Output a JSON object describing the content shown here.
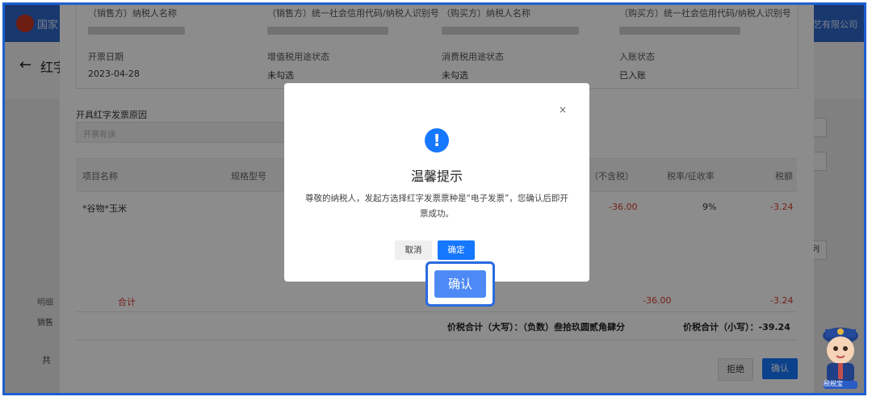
{
  "app": {
    "title_partial": "国家",
    "company_partial": "艺有限公司"
  },
  "page": {
    "title_partial": "红字"
  },
  "background_left": {
    "label1": "明细",
    "label2": "销售",
    "label3": "共"
  },
  "right_side": {
    "button_partial": "列"
  },
  "invoice_info": {
    "seller_name_label": "（销售方）纳税人名称",
    "seller_id_label": "（销售方）统一社会信用代码/纳税人识别号",
    "buyer_name_label": "（购买方）纳税人名称",
    "buyer_id_label": "（购买方）统一社会信用代码/纳税人识别号",
    "issue_date_label": "开票日期",
    "issue_date_value": "2023-04-28",
    "vat_use_status_label": "增值税用途状态",
    "vat_use_status_value": "未勾选",
    "consumption_tax_status_label": "消费税用途状态",
    "consumption_tax_status_value": "未勾选",
    "accounting_status_label": "入账状态",
    "accounting_status_value": "已入账"
  },
  "reason": {
    "label": "开具红字发票原因",
    "value": "开票有误"
  },
  "table": {
    "headers": [
      "项目名称",
      "规格型号",
      "（不含税）",
      "税率/征收率",
      "税额"
    ],
    "rows": [
      {
        "item": "*谷物*玉米",
        "amount": "-36.00",
        "rate": "9%",
        "tax": "-3.24"
      }
    ],
    "total_label": "合计",
    "total_amount": "-36.00",
    "total_tax": "-3.24",
    "grand_total_upper": "价税合计（大写）：（负数）叁拾玖圆贰角肆分",
    "grand_total_lower": "价税合计（小写）：-39.24"
  },
  "drawer_buttons": {
    "reject": "拒绝",
    "confirm": "确认"
  },
  "modal": {
    "close": "×",
    "icon": "!",
    "title": "温馨提示",
    "body": "尊敬的纳税人，发起方选择红字发票票种是“电子发票”，您确认后即开票成功。",
    "cancel": "取消",
    "ok": "确定"
  },
  "callout": {
    "label": "确认"
  },
  "mascot": {
    "label": "税税宝"
  },
  "colors": {
    "primary": "#1677ff",
    "topbar": "#2f66c8",
    "negative": "#d83a2f",
    "frame": "#1d5fd1"
  }
}
